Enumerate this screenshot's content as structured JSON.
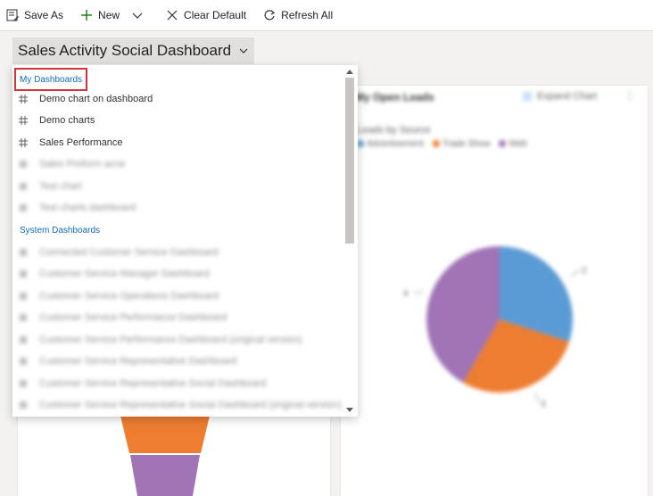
{
  "toolbar": {
    "save_as": "Save As",
    "new": "New",
    "clear_default": "Clear Default",
    "refresh_all": "Refresh All"
  },
  "dashboard": {
    "title": "Sales Activity Social Dashboard"
  },
  "dropdown": {
    "my_dashboards_header": "My Dashboards",
    "my_items": [
      {
        "label": "Demo chart on dashboard",
        "icon": "dashboard-grid-icon"
      },
      {
        "label": "Demo charts",
        "icon": "dashboard-grid-icon"
      },
      {
        "label": "Sales Performance",
        "icon": "dashboard-grid-icon"
      },
      {
        "label": "Sales Preform acne",
        "icon": "dashboard-icon"
      },
      {
        "label": "Test chart",
        "icon": "dashboard-icon"
      },
      {
        "label": "Test charts dashboard",
        "icon": "dashboard-icon"
      }
    ],
    "system_dashboards_header": "System Dashboards",
    "system_items": [
      {
        "label": "Connected Customer Service Dashboard",
        "icon": "dashboard-icon"
      },
      {
        "label": "Customer Service Manager Dashboard",
        "icon": "dashboard-icon"
      },
      {
        "label": "Customer Service Operations Dashboard",
        "icon": "dashboard-icon"
      },
      {
        "label": "Customer Service Performance Dashboard",
        "icon": "dashboard-icon"
      },
      {
        "label": "Customer Service Performance Dashboard (original version)",
        "icon": "dashboard-icon"
      },
      {
        "label": "Customer Service Representative Dashboard",
        "icon": "dashboard-icon"
      },
      {
        "label": "Customer Service Representative Social Dashboard",
        "icon": "dashboard-icon"
      },
      {
        "label": "Customer Service Representative Social Dashboard (original version)",
        "icon": "dashboard-icon"
      }
    ]
  },
  "right_card": {
    "title": "My Open Leads",
    "expand_chart": "Expand Chart",
    "more": "⋮",
    "subtitle": "Leads by Source",
    "legend": [
      {
        "name": "Advertisement",
        "color": "#5b9bd5"
      },
      {
        "name": "Trade Show",
        "color": "#ed7d31"
      },
      {
        "name": "Web",
        "color": "#a074b5"
      }
    ],
    "labels": [
      "2",
      "3",
      "4"
    ]
  },
  "colors": {
    "accent": "#0f6cbd",
    "highlight": "#d13438",
    "pie_blue": "#5b9bd5",
    "pie_orange": "#ed7d31",
    "pie_purple": "#a074b5"
  }
}
